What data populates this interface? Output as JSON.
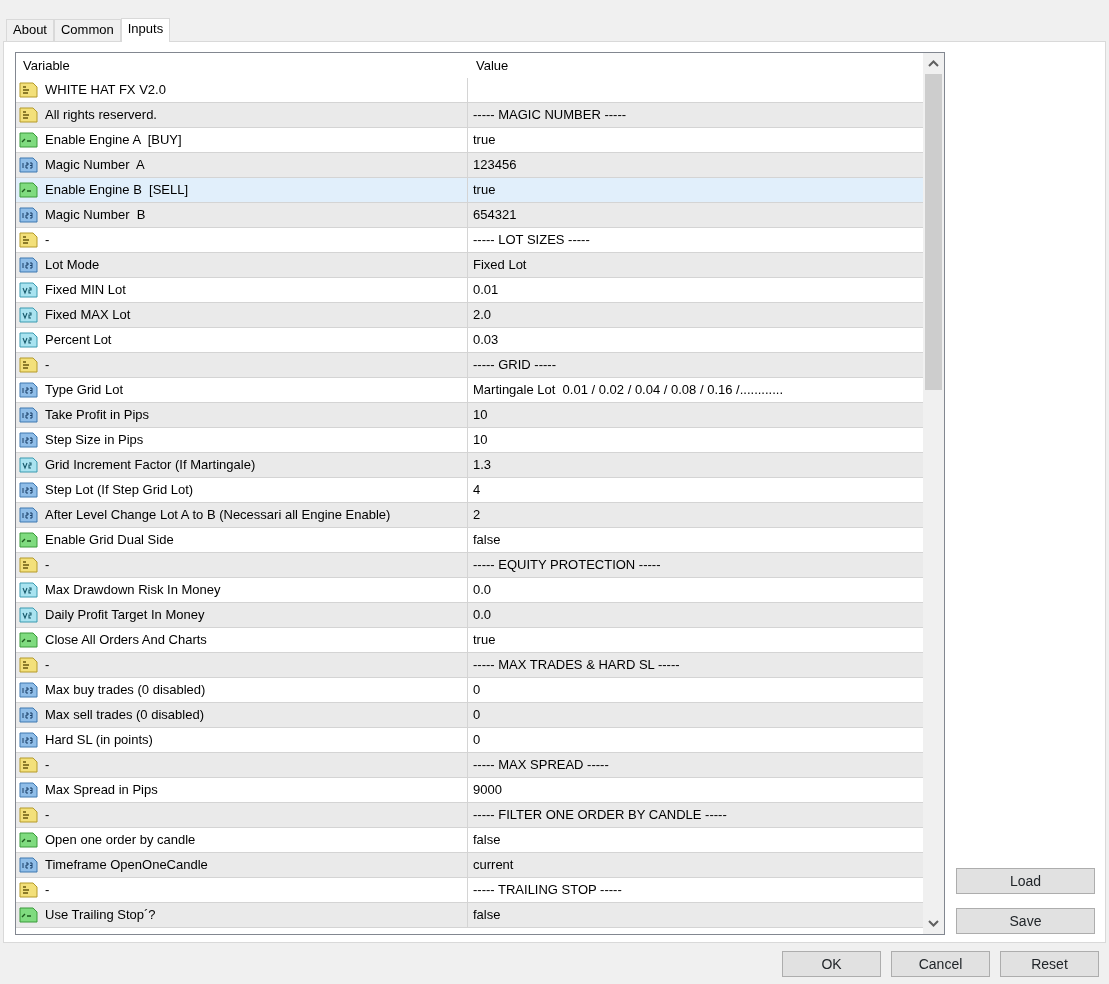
{
  "tabs": [
    {
      "label": "About",
      "selected": false
    },
    {
      "label": "Common",
      "selected": false
    },
    {
      "label": "Inputs",
      "selected": true
    }
  ],
  "table": {
    "columns": [
      "Variable",
      "Value"
    ],
    "rows": [
      {
        "kind": "string",
        "variable": "WHITE HAT FX V2.0",
        "value": "",
        "selected": false
      },
      {
        "kind": "string",
        "variable": "All rights reserverd.",
        "value": "----- MAGIC NUMBER -----",
        "selected": false
      },
      {
        "kind": "bool",
        "variable": "Enable Engine A  [BUY]",
        "value": "true",
        "selected": false
      },
      {
        "kind": "int",
        "variable": "Magic Number  A",
        "value": "123456",
        "selected": false
      },
      {
        "kind": "bool",
        "variable": "Enable Engine B  [SELL]",
        "value": "true",
        "selected": true
      },
      {
        "kind": "int",
        "variable": "Magic Number  B",
        "value": "654321",
        "selected": false
      },
      {
        "kind": "string",
        "variable": "-",
        "value": "----- LOT SIZES -----",
        "selected": false
      },
      {
        "kind": "int",
        "variable": "Lot Mode",
        "value": "Fixed Lot",
        "selected": false
      },
      {
        "kind": "double",
        "variable": "Fixed MIN Lot",
        "value": "0.01",
        "selected": false
      },
      {
        "kind": "double",
        "variable": "Fixed MAX Lot",
        "value": "2.0",
        "selected": false
      },
      {
        "kind": "double",
        "variable": "Percent Lot",
        "value": "0.03",
        "selected": false
      },
      {
        "kind": "string",
        "variable": "-",
        "value": "----- GRID -----",
        "selected": false
      },
      {
        "kind": "int",
        "variable": "Type Grid Lot",
        "value": "Martingale Lot  0.01 / 0.02 / 0.04 / 0.08 / 0.16 /............",
        "selected": false
      },
      {
        "kind": "int",
        "variable": "Take Profit in Pips",
        "value": "10",
        "selected": false
      },
      {
        "kind": "int",
        "variable": "Step Size in Pips",
        "value": "10",
        "selected": false
      },
      {
        "kind": "double",
        "variable": "Grid Increment Factor (If Martingale)",
        "value": "1.3",
        "selected": false
      },
      {
        "kind": "int",
        "variable": "Step Lot (If Step Grid Lot)",
        "value": "4",
        "selected": false
      },
      {
        "kind": "int",
        "variable": "After Level Change Lot A to B (Necessari all Engine Enable)",
        "value": "2",
        "selected": false
      },
      {
        "kind": "bool",
        "variable": "Enable Grid Dual Side",
        "value": "false",
        "selected": false
      },
      {
        "kind": "string",
        "variable": "-",
        "value": "----- EQUITY PROTECTION -----",
        "selected": false
      },
      {
        "kind": "double",
        "variable": "Max Drawdown Risk In Money",
        "value": "0.0",
        "selected": false
      },
      {
        "kind": "double",
        "variable": "Daily Profit Target In Money",
        "value": "0.0",
        "selected": false
      },
      {
        "kind": "bool",
        "variable": "Close All Orders And Charts",
        "value": "true",
        "selected": false
      },
      {
        "kind": "string",
        "variable": "-",
        "value": "----- MAX TRADES & HARD SL -----",
        "selected": false
      },
      {
        "kind": "int",
        "variable": "Max buy trades (0 disabled)",
        "value": "0",
        "selected": false
      },
      {
        "kind": "int",
        "variable": "Max sell trades (0 disabled)",
        "value": "0",
        "selected": false
      },
      {
        "kind": "int",
        "variable": "Hard SL (in points)",
        "value": "0",
        "selected": false
      },
      {
        "kind": "string",
        "variable": "-",
        "value": "----- MAX SPREAD -----",
        "selected": false
      },
      {
        "kind": "int",
        "variable": "Max Spread in Pips",
        "value": "9000",
        "selected": false
      },
      {
        "kind": "string",
        "variable": "-",
        "value": "----- FILTER ONE ORDER BY CANDLE -----",
        "selected": false
      },
      {
        "kind": "bool",
        "variable": "Open one order by candle",
        "value": "false",
        "selected": false
      },
      {
        "kind": "int",
        "variable": "Timeframe OpenOneCandle",
        "value": "current",
        "selected": false
      },
      {
        "kind": "string",
        "variable": "-",
        "value": "----- TRAILING STOP -----",
        "selected": false
      },
      {
        "kind": "bool",
        "variable": "Use Trailing Stop´?",
        "value": "false",
        "selected": false
      }
    ]
  },
  "side_buttons": [
    "Load",
    "Save"
  ],
  "buttons": [
    "OK",
    "Cancel",
    "Reset"
  ]
}
